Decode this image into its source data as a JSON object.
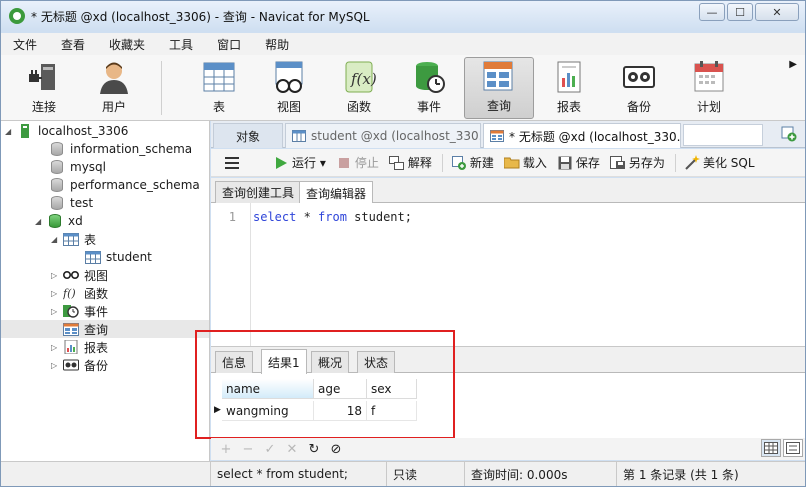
{
  "window": {
    "title": "* 无标题 @xd (localhost_3306) - 查询 - Navicat for MySQL",
    "buttons": {
      "minimize": "—",
      "maximize": "☐",
      "close": "✕"
    }
  },
  "menu": [
    "文件",
    "查看",
    "收藏夹",
    "工具",
    "窗口",
    "帮助"
  ],
  "toolbar": {
    "items": [
      {
        "label": "连接",
        "icon": "connection-icon"
      },
      {
        "label": "用户",
        "icon": "user-icon"
      },
      {
        "label": "表",
        "icon": "table-icon"
      },
      {
        "label": "视图",
        "icon": "view-icon"
      },
      {
        "label": "函数",
        "icon": "function-icon"
      },
      {
        "label": "事件",
        "icon": "event-icon"
      },
      {
        "label": "查询",
        "icon": "query-icon",
        "active": true
      },
      {
        "label": "报表",
        "icon": "report-icon"
      },
      {
        "label": "备份",
        "icon": "backup-icon"
      },
      {
        "label": "计划",
        "icon": "schedule-icon"
      }
    ],
    "more": "▶"
  },
  "tree": {
    "connection": "localhost_3306",
    "databases": [
      "information_schema",
      "mysql",
      "performance_schema",
      "test",
      "xd"
    ],
    "xd_children": {
      "tables_group": "表",
      "table": "student",
      "views": "视图",
      "functions": "函数",
      "events": "事件",
      "queries": "查询",
      "reports": "报表",
      "backups": "备份"
    }
  },
  "tabs": {
    "objects": "对象",
    "student_tab": "student @xd (localhost_330...",
    "query_tab": "* 无标题 @xd (localhost_330..."
  },
  "query_toolbar": {
    "run": "运行 ▾",
    "stop": "停止",
    "explain": "解释",
    "new": "新建",
    "load": "载入",
    "save": "保存",
    "save_as": "另存为",
    "beautify": "美化 SQL"
  },
  "subtabs": {
    "builder": "查询创建工具",
    "editor": "查询编辑器"
  },
  "editor": {
    "line_number": "1",
    "kw_select": "select",
    "star": " * ",
    "kw_from": "from",
    "rest": " student;"
  },
  "result": {
    "tabs": [
      "信息",
      "结果1",
      "概况",
      "状态"
    ],
    "active_tab": "结果1",
    "columns": [
      "name",
      "age",
      "sex"
    ],
    "rows": [
      [
        "wangming",
        "18",
        "f"
      ]
    ]
  },
  "status": {
    "sql": "select * from student;",
    "mode": "只读",
    "time": "查询时间: 0.000s",
    "records": "第 1 条记录 (共 1 条)"
  },
  "colors": {
    "highlight_box": "#e02020",
    "keyword": "#2f45d9"
  }
}
